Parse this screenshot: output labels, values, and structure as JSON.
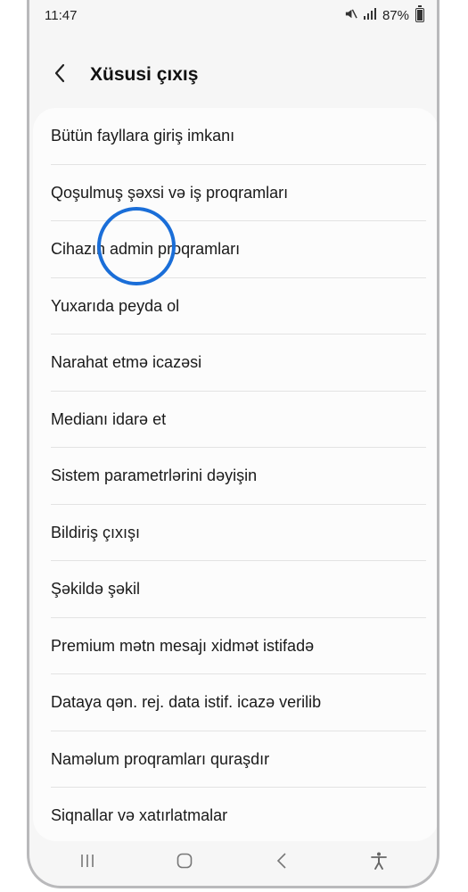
{
  "status_bar": {
    "time": "11:47",
    "battery": "87%",
    "battery_level": 0.87,
    "icons": [
      "mute-icon",
      "signal-icon",
      "battery-icon"
    ]
  },
  "header": {
    "title": "Xüsusi çıxış",
    "back_icon": "chevron-left-icon"
  },
  "items": [
    "Bütün fayllara giriş imkanı",
    "Qoşulmuş şəxsi və iş proqramları",
    "Cihazın admin proqramları",
    "Yuxarıda peyda ol",
    "Narahat etmə icazəsi",
    "Medianı idarə et",
    "Sistem parametrlərini dəyişin",
    "Bildiriş çıxışı",
    "Şəkildə şəkil",
    "Premium mətn mesajı xidmət istifadə",
    "Dataya qən. rej. data istif. icazə verilib",
    "Naməlum proqramları quraşdır",
    "Siqnallar və xatırlatmalar"
  ],
  "highlight": {
    "item_index": 2,
    "color": "#1a6ed8"
  },
  "navbar": [
    "recents-icon",
    "home-icon",
    "back-icon",
    "accessibility-icon"
  ]
}
